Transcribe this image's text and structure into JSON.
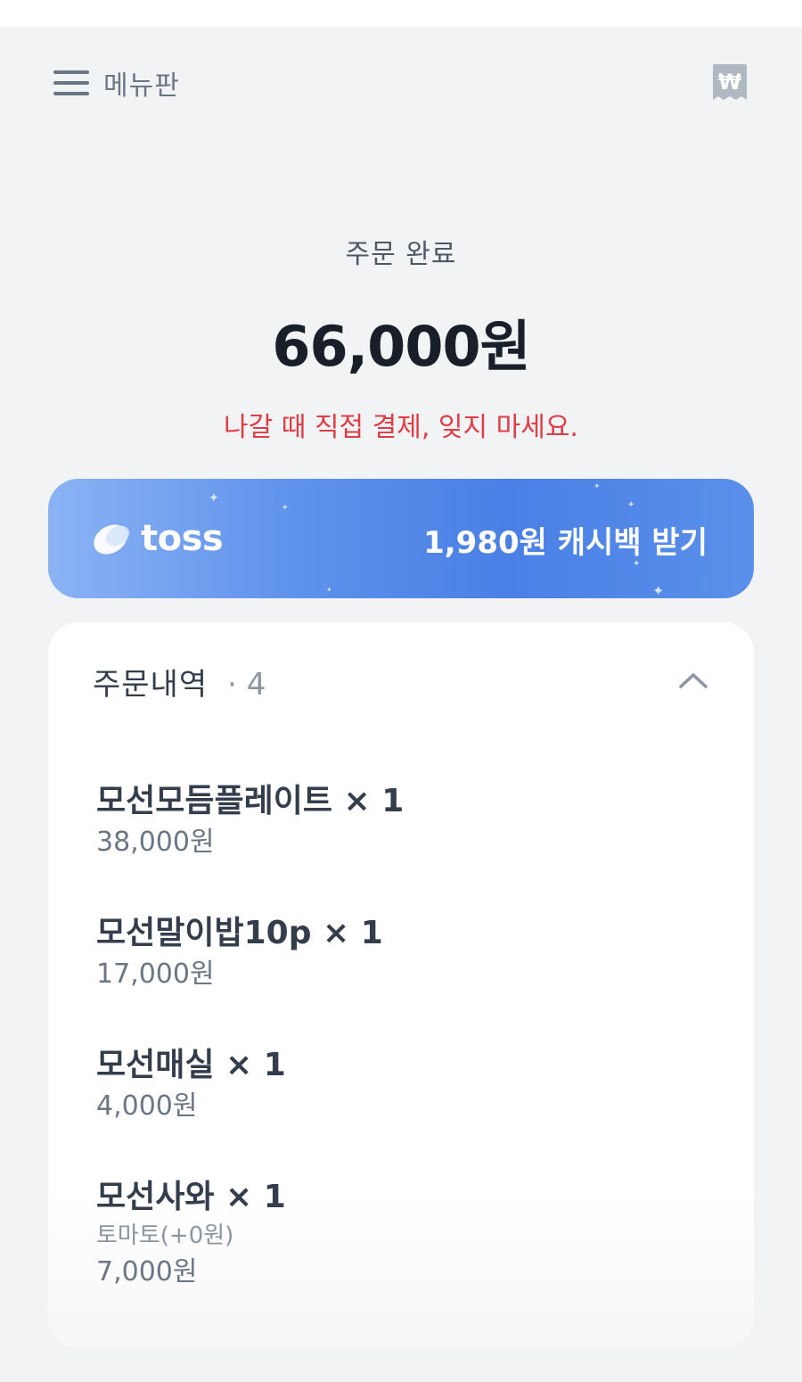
{
  "header": {
    "menu_label": "메뉴판",
    "receipt_icon": "won-receipt-icon",
    "receipt_symbol": "₩"
  },
  "summary": {
    "status": "주문 완료",
    "total": "66,000원",
    "notice": "나갈 때 직접 결제, 잊지 마세요."
  },
  "toss": {
    "brand": "toss",
    "cashback": "1,980원 캐시백 받기"
  },
  "orders": {
    "title": "주문내역",
    "count": "· 4",
    "expanded": true,
    "items": [
      {
        "name": "모선모듬플레이트 × 1",
        "price": "38,000원"
      },
      {
        "name": "모선말이밥10p × 1",
        "price": "17,000원"
      },
      {
        "name": "모선매실 × 1",
        "price": "4,000원"
      },
      {
        "name": "모선사와 × 1",
        "option": "토마토(+0원)",
        "price": "7,000원"
      }
    ]
  },
  "colors": {
    "background": "#f2f3f5",
    "notice_red": "#e03c45",
    "toss_blue": "#4a80e5",
    "text_dark": "#191f28",
    "text_gray": "#6b7684"
  }
}
